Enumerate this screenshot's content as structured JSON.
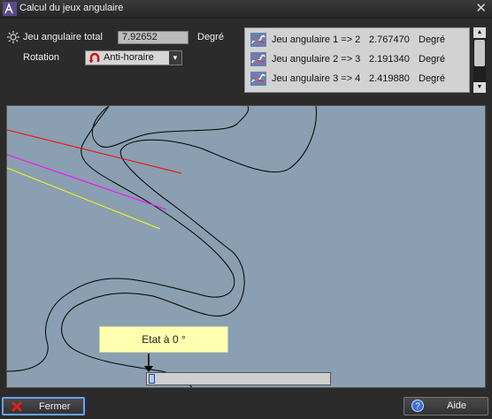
{
  "window": {
    "title": "Calcul du jeux angulaire"
  },
  "params": {
    "total_label": "Jeu angulaire total",
    "total_value": "7.92652",
    "total_unit": "Degré",
    "rotation_label": "Rotation",
    "rotation_value": "Anti-horaire"
  },
  "results": [
    {
      "label": "Jeu angulaire 1 => 2",
      "value": "2.767470",
      "unit": "Degré"
    },
    {
      "label": "Jeu angulaire 2 => 3",
      "value": "2.191340",
      "unit": "Degré"
    },
    {
      "label": "Jeu angulaire 3 => 4",
      "value": "2.419880",
      "unit": "Degré"
    }
  ],
  "canvas": {
    "tooltip": "Etat à 0 °",
    "slider_value": 0,
    "colors": {
      "background": "#8a9fb1",
      "line1": "#ff0000",
      "line2": "#ff00ff",
      "line3": "#ffff00"
    }
  },
  "buttons": {
    "close": "Fermer",
    "help": "Aide"
  },
  "icons": {
    "app": "app-icon",
    "total": "sun-icon",
    "rotation": "counterclockwise-arrow-icon",
    "result": "angle-link-icon",
    "close_button": "red-x-icon",
    "help_button": "question-mark-icon"
  }
}
